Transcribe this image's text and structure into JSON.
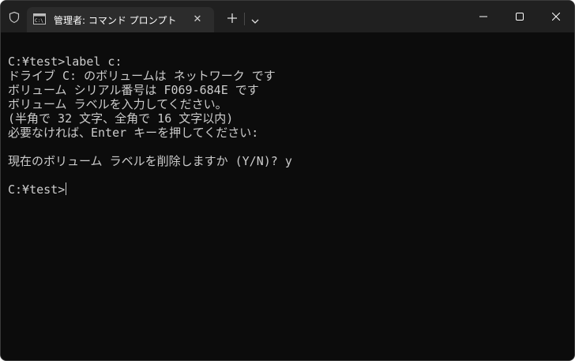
{
  "window": {
    "tab_title": "管理者: コマンド プロンプト",
    "close_tab_glyph": "✕"
  },
  "terminal": {
    "lines": [
      "",
      "C:¥test>label c:",
      "ドライブ C: のボリュームは ネットワーク です",
      "ボリューム シリアル番号は F069-684E です",
      "ボリューム ラベルを入力してください。",
      "(半角で 32 文字、全角で 16 文字以内)",
      "必要なければ、Enter キーを押してください:",
      "",
      "現在のボリューム ラベルを削除しますか (Y/N)? y",
      "",
      "C:¥test>"
    ]
  },
  "colors": {
    "terminal_bg": "#0c0c0c",
    "titlebar_bg": "#202020",
    "tab_bg": "#2c2c2c",
    "text": "#cccccc"
  },
  "icons": [
    "shield-icon",
    "cmd-icon",
    "close-tab-icon",
    "plus-icon",
    "chevron-down-icon",
    "minimize-icon",
    "maximize-icon",
    "close-icon"
  ]
}
